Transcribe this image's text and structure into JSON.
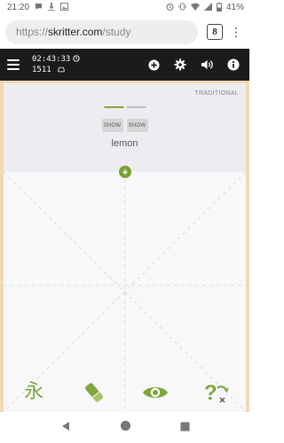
{
  "status_bar": {
    "time": "21:20",
    "battery_percent": "41%",
    "left_icons": [
      "chat-bubble-icon",
      "download-icon",
      "image-icon"
    ],
    "right_icons": [
      "alarm-icon",
      "vibrate-icon",
      "wifi-icon",
      "signal-icon",
      "battery-icon"
    ]
  },
  "browser": {
    "url_scheme": "https://",
    "url_domain": "skritter.com",
    "url_path": "/study",
    "tab_count": "8"
  },
  "toolbar": {
    "timer": "02:43:33",
    "count": "1511",
    "icons": [
      "add-icon",
      "settings-icon",
      "volume-icon",
      "info-icon"
    ]
  },
  "prompt": {
    "mode_label": "TRADITIONAL",
    "progress_done_fraction": 0.5,
    "show_buttons": [
      "SHOW",
      "SHOW"
    ],
    "definition": "lemon"
  },
  "tools": {
    "stroke_order_glyph": "永",
    "items": [
      "stroke-order-icon",
      "eraser-icon",
      "reveal-eye-icon",
      "hint-icon"
    ]
  },
  "colors": {
    "accent_green": "#7fa63a",
    "app_bar": "#1b1b1b",
    "frame": "#f1d9b4"
  }
}
